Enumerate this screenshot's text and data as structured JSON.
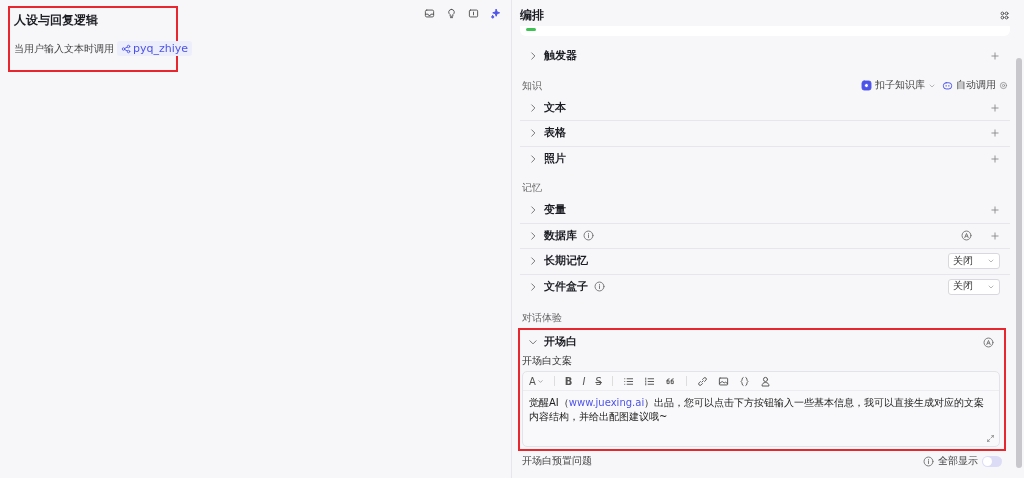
{
  "left_panel": {
    "title": "人设与回复逻辑",
    "highlighted": true,
    "trigger_text": "当用户输入文本时调用",
    "plugin_tag": "pyq_zhiye"
  },
  "right_panel": {
    "title": "编排",
    "sections": [
      {
        "items": [
          {
            "label": "触发器",
            "kind": "add",
            "info": false,
            "expanded": false
          }
        ]
      },
      {
        "heading": "知识",
        "source": "扣子知识库",
        "mode": "自动调用",
        "items": [
          {
            "label": "文本",
            "kind": "add",
            "info": false,
            "expanded": false
          },
          {
            "label": "表格",
            "kind": "add",
            "info": false,
            "expanded": false
          },
          {
            "label": "照片",
            "kind": "add",
            "info": false,
            "expanded": false
          }
        ]
      },
      {
        "heading": "记忆",
        "items": [
          {
            "label": "变量",
            "kind": "add",
            "info": false,
            "expanded": false
          },
          {
            "label": "数据库",
            "kind": "add_badge",
            "info": true,
            "expanded": false
          },
          {
            "label": "长期记忆",
            "kind": "select",
            "value": "关闭",
            "info": false,
            "expanded": false
          },
          {
            "label": "文件盒子",
            "kind": "select",
            "value": "关闭",
            "info": true,
            "expanded": false
          }
        ]
      }
    ],
    "dialogue": {
      "heading": "对话体验",
      "opening": {
        "label": "开场白",
        "expanded": true,
        "highlighted": true,
        "field_label": "开场白文案",
        "font_glyph": "A",
        "format_glyphs": [
          "B",
          "I",
          "S"
        ],
        "text_before": "觉醒AI（",
        "link": "www.juexing.ai",
        "text_after": "）出品，您可以点击下方按钮输入一些基本信息，我可以直接生成对应的文案内容结构，并给出配图建议哦~"
      },
      "next_item": {
        "label": "开场白预置问题",
        "toggle_label": "全部显示",
        "on": false
      }
    }
  }
}
